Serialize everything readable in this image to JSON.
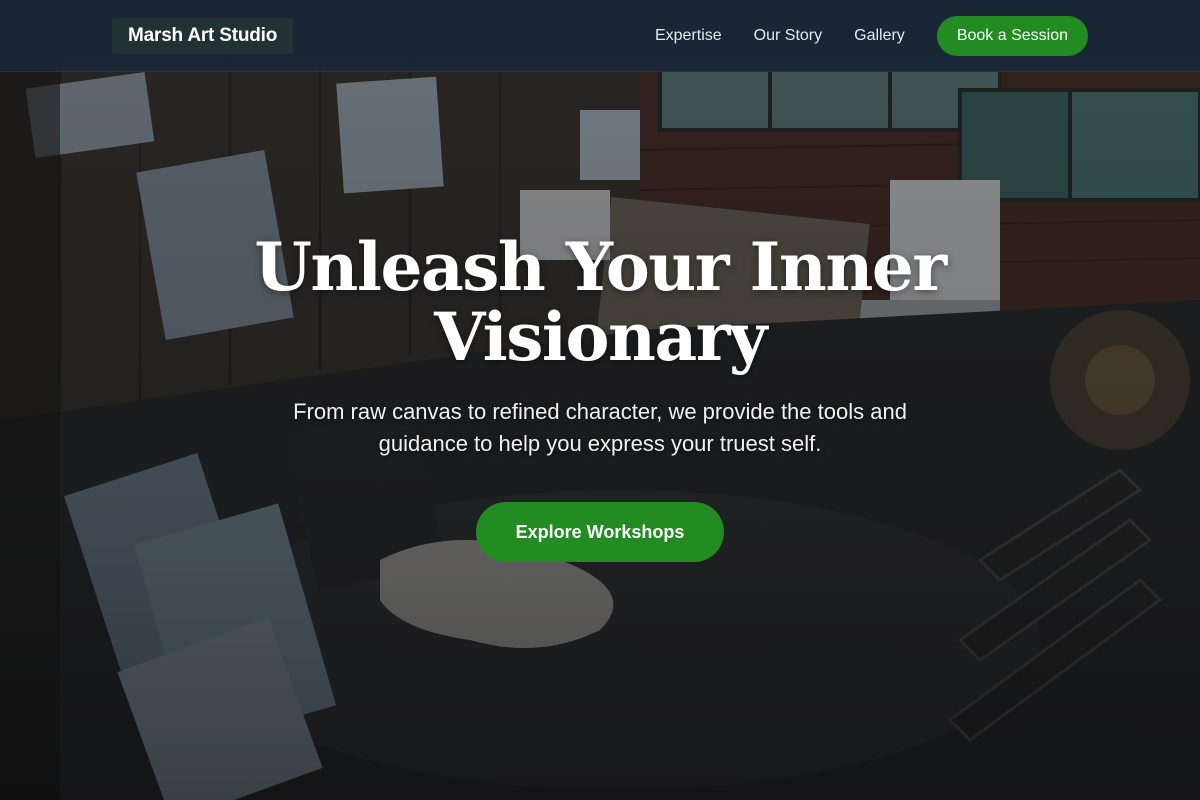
{
  "nav": {
    "brand": "Marsh Art Studio",
    "links": [
      "Expertise",
      "Our Story",
      "Gallery"
    ],
    "cta_label": "Book a Session"
  },
  "hero": {
    "title": "Unleash Your Inner Visionary",
    "subtitle": "From raw canvas to refined character, we provide the tools and guidance to help you express your truest self.",
    "cta_label": "Explore Workshops",
    "background_icon": "art-studio-photo"
  },
  "colors": {
    "accent": "#228B22",
    "navbar": "#1B2638",
    "text": "#FFFFFF"
  }
}
